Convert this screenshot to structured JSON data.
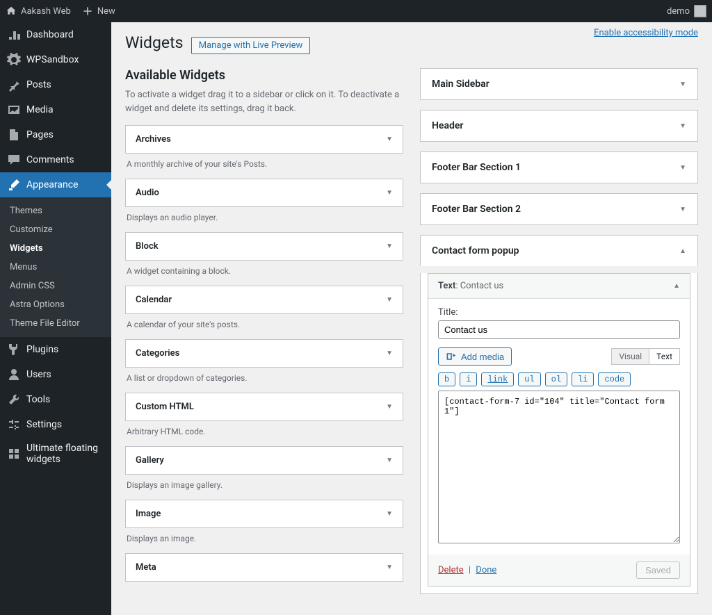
{
  "toolbar": {
    "site": "Aakash Web",
    "new": "New",
    "user": "demo"
  },
  "menu": [
    {
      "label": "Dashboard",
      "icon": "dash"
    },
    {
      "label": "WPSandbox",
      "icon": "gear"
    },
    {
      "label": "Posts",
      "icon": "pin"
    },
    {
      "label": "Media",
      "icon": "media"
    },
    {
      "label": "Pages",
      "icon": "page"
    },
    {
      "label": "Comments",
      "icon": "comment"
    },
    {
      "label": "Appearance",
      "icon": "brush",
      "current": true
    },
    {
      "label": "Plugins",
      "icon": "plug"
    },
    {
      "label": "Users",
      "icon": "user"
    },
    {
      "label": "Tools",
      "icon": "wrench"
    },
    {
      "label": "Settings",
      "icon": "sliders"
    },
    {
      "label": "Ultimate floating widgets",
      "icon": "ufw"
    }
  ],
  "submenu": [
    "Themes",
    "Customize",
    "Widgets",
    "Menus",
    "Admin CSS",
    "Astra Options",
    "Theme File Editor"
  ],
  "submenu_current": "Widgets",
  "page": {
    "title": "Widgets",
    "preview_btn": "Manage with Live Preview",
    "a11y": "Enable accessibility mode",
    "available_heading": "Available Widgets",
    "available_desc": "To activate a widget drag it to a sidebar or click on it. To deactivate a widget and delete its settings, drag it back."
  },
  "widgets": [
    {
      "name": "Archives",
      "desc": "A monthly archive of your site's Posts."
    },
    {
      "name": "Audio",
      "desc": "Displays an audio player."
    },
    {
      "name": "Block",
      "desc": "A widget containing a block."
    },
    {
      "name": "Calendar",
      "desc": "A calendar of your site's posts."
    },
    {
      "name": "Categories",
      "desc": "A list or dropdown of categories."
    },
    {
      "name": "Custom HTML",
      "desc": "Arbitrary HTML code."
    },
    {
      "name": "Gallery",
      "desc": "Displays an image gallery."
    },
    {
      "name": "Image",
      "desc": "Displays an image."
    },
    {
      "name": "Meta",
      "desc": ""
    }
  ],
  "sidebars": [
    "Main Sidebar",
    "Header",
    "Footer Bar Section 1",
    "Footer Bar Section 2"
  ],
  "open_sidebar": {
    "title": "Contact form popup",
    "widget_prefix": "Text",
    "widget_suffix": ": Contact us",
    "title_label": "Title:",
    "title_value": "Contact us",
    "add_media": "Add media",
    "tabs": {
      "visual": "Visual",
      "text": "Text"
    },
    "qt": [
      "b",
      "i",
      "link",
      "ul",
      "ol",
      "li",
      "code"
    ],
    "textarea": "[contact-form-7 id=\"104\" title=\"Contact form 1\"]",
    "delete": "Delete",
    "done": "Done",
    "saved": "Saved"
  }
}
